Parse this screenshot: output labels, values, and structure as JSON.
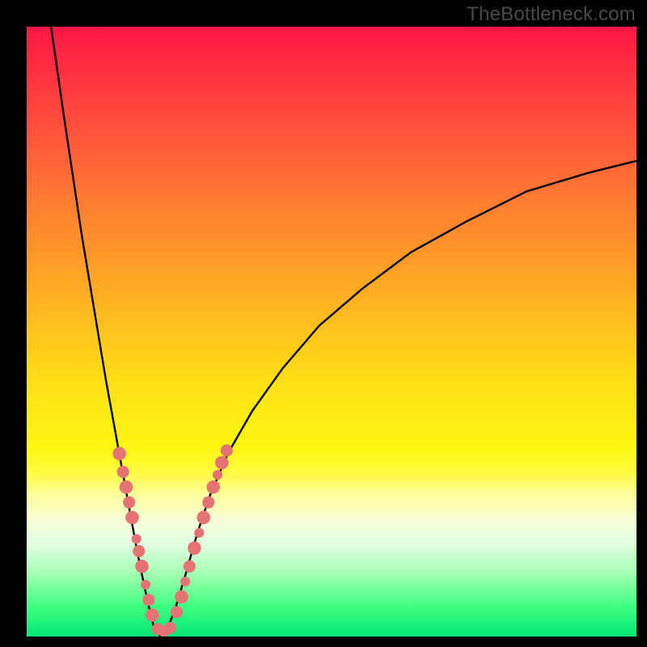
{
  "watermark": "TheBottleneck.com",
  "colors": {
    "frame": "#000000",
    "curve": "#000000",
    "bead": "#e57373"
  },
  "chart_data": {
    "type": "line",
    "title": "",
    "xlabel": "",
    "ylabel": "",
    "xlim": [
      0,
      100
    ],
    "ylim": [
      0,
      100
    ],
    "grid": false,
    "curve_note": "V-shaped bottleneck curve. x is normalized horizontal position (0–100 left→right). y is bottleneck percentage (0 at bottom/green, 100 at top/red). The curve has its minimum near x≈21 where y≈0, rises steeply to the left reaching y≈100 near x≈4, and rises more gradually to the right reaching y≈78 at x≈100.",
    "curve": [
      {
        "x": 4.0,
        "y": 100.0
      },
      {
        "x": 5.0,
        "y": 93.0
      },
      {
        "x": 6.0,
        "y": 86.0
      },
      {
        "x": 7.5,
        "y": 76.0
      },
      {
        "x": 9.0,
        "y": 66.0
      },
      {
        "x": 11.0,
        "y": 54.0
      },
      {
        "x": 13.0,
        "y": 42.0
      },
      {
        "x": 15.0,
        "y": 31.0
      },
      {
        "x": 17.0,
        "y": 20.0
      },
      {
        "x": 18.5,
        "y": 12.0
      },
      {
        "x": 20.0,
        "y": 5.0
      },
      {
        "x": 21.0,
        "y": 1.0
      },
      {
        "x": 22.0,
        "y": 0.0
      },
      {
        "x": 23.0,
        "y": 1.0
      },
      {
        "x": 24.5,
        "y": 5.0
      },
      {
        "x": 26.0,
        "y": 10.0
      },
      {
        "x": 28.0,
        "y": 17.0
      },
      {
        "x": 30.0,
        "y": 23.0
      },
      {
        "x": 33.0,
        "y": 30.0
      },
      {
        "x": 37.0,
        "y": 37.0
      },
      {
        "x": 42.0,
        "y": 44.0
      },
      {
        "x": 48.0,
        "y": 51.0
      },
      {
        "x": 55.0,
        "y": 57.0
      },
      {
        "x": 63.0,
        "y": 63.0
      },
      {
        "x": 72.0,
        "y": 68.0
      },
      {
        "x": 82.0,
        "y": 73.0
      },
      {
        "x": 92.0,
        "y": 76.0
      },
      {
        "x": 100.0,
        "y": 78.0
      }
    ],
    "bead_clusters_note": "Salmon bead markers clustered along both arms of the V near the bottom (low-bottleneck region). Values are (x, y) on the same 0–100 scale.",
    "beads_left": [
      {
        "x": 15.2,
        "y": 30.0,
        "r": 1.1
      },
      {
        "x": 15.8,
        "y": 27.0,
        "r": 1.0
      },
      {
        "x": 16.3,
        "y": 24.5,
        "r": 1.1
      },
      {
        "x": 16.8,
        "y": 22.0,
        "r": 1.0
      },
      {
        "x": 17.3,
        "y": 19.5,
        "r": 1.1
      },
      {
        "x": 18.0,
        "y": 16.0,
        "r": 0.8
      },
      {
        "x": 18.4,
        "y": 14.0,
        "r": 1.0
      },
      {
        "x": 18.9,
        "y": 11.5,
        "r": 1.1
      },
      {
        "x": 19.5,
        "y": 8.5,
        "r": 0.8
      },
      {
        "x": 20.0,
        "y": 6.0,
        "r": 1.0
      },
      {
        "x": 20.6,
        "y": 3.5,
        "r": 1.1
      }
    ],
    "beads_bottom": [
      {
        "x": 21.5,
        "y": 1.2,
        "r": 1.0
      },
      {
        "x": 22.5,
        "y": 0.8,
        "r": 0.9
      },
      {
        "x": 23.5,
        "y": 1.4,
        "r": 1.0
      }
    ],
    "beads_right": [
      {
        "x": 24.6,
        "y": 4.0,
        "r": 1.0
      },
      {
        "x": 25.4,
        "y": 6.5,
        "r": 1.1
      },
      {
        "x": 26.0,
        "y": 9.0,
        "r": 0.8
      },
      {
        "x": 26.7,
        "y": 11.5,
        "r": 1.0
      },
      {
        "x": 27.5,
        "y": 14.5,
        "r": 1.1
      },
      {
        "x": 28.3,
        "y": 17.0,
        "r": 0.8
      },
      {
        "x": 29.0,
        "y": 19.5,
        "r": 1.1
      },
      {
        "x": 29.8,
        "y": 22.0,
        "r": 1.0
      },
      {
        "x": 30.6,
        "y": 24.5,
        "r": 1.1
      },
      {
        "x": 31.3,
        "y": 26.5,
        "r": 0.8
      },
      {
        "x": 32.0,
        "y": 28.5,
        "r": 1.1
      },
      {
        "x": 32.8,
        "y": 30.5,
        "r": 1.0
      }
    ]
  }
}
